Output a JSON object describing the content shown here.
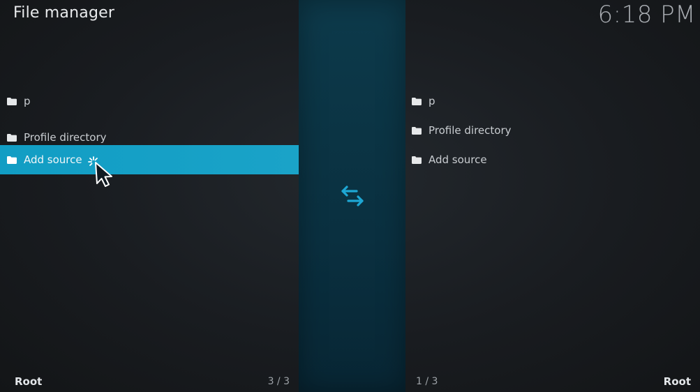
{
  "app": {
    "title": "File manager",
    "clock": "6:18 PM"
  },
  "left_panel": {
    "items": [
      {
        "label": "p",
        "icon": "folder-icon"
      },
      {
        "label": "Profile directory",
        "icon": "folder-icon"
      },
      {
        "label": "Add source",
        "icon": "folder-icon",
        "selected": true
      }
    ],
    "footer_path": "Root",
    "footer_count": "3 / 3"
  },
  "right_panel": {
    "items": [
      {
        "label": "p",
        "icon": "folder-icon"
      },
      {
        "label": "Profile directory",
        "icon": "folder-icon"
      },
      {
        "label": "Add source",
        "icon": "folder-icon"
      }
    ],
    "footer_path": "Root",
    "footer_count": "1 / 3"
  },
  "center": {
    "icon": "swap-arrows-icon"
  },
  "colors": {
    "accent": "#12a0c6",
    "center_strip": "#0b3444",
    "background": "#16191c"
  }
}
